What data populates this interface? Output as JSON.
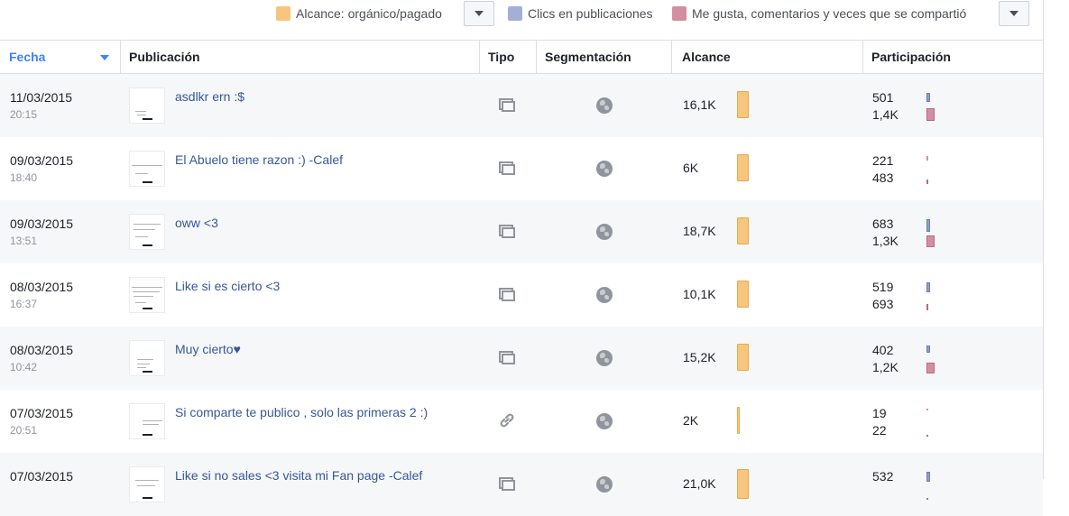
{
  "legend": {
    "items": [
      {
        "label": "Alcance: orgánico/pagado",
        "color": "#f7c67e"
      },
      {
        "label": "Clics en publicaciones",
        "color": "#a3afd4"
      },
      {
        "label": "Me gusta, comentarios y veces que se compartió",
        "color": "#d48ea1"
      }
    ]
  },
  "table": {
    "headers": {
      "fecha": "Fecha",
      "publicacion": "Publicación",
      "tipo": "Tipo",
      "segmentacion": "Segmentación",
      "alcance": "Alcance",
      "participacion": "Participación"
    },
    "rows": [
      {
        "date": "11/03/2015",
        "time": "20:15",
        "title": "asdlkr ern :$",
        "type_icon": "photo-icon",
        "targeting_icon": "globe-icon",
        "reach": "16,1K",
        "reach_value": 16100,
        "clicks": "501",
        "clicks_value": 501,
        "engagement": "1,4K",
        "engagement_value": 1400
      },
      {
        "date": "09/03/2015",
        "time": "18:40",
        "title": "El Abuelo tiene razon :) -Calef",
        "type_icon": "photo-icon",
        "targeting_icon": "globe-icon",
        "reach": "6K",
        "reach_value": 6000,
        "clicks": "221",
        "clicks_value": 221,
        "engagement": "483",
        "engagement_value": 483
      },
      {
        "date": "09/03/2015",
        "time": "13:51",
        "title": "oww <3",
        "type_icon": "photo-icon",
        "targeting_icon": "globe-icon",
        "reach": "18,7K",
        "reach_value": 18700,
        "clicks": "683",
        "clicks_value": 683,
        "engagement": "1,3K",
        "engagement_value": 1300
      },
      {
        "date": "08/03/2015",
        "time": "16:37",
        "title": "Like si es cierto <3",
        "type_icon": "photo-icon",
        "targeting_icon": "globe-icon",
        "reach": "10,1K",
        "reach_value": 10100,
        "clicks": "519",
        "clicks_value": 519,
        "engagement": "693",
        "engagement_value": 693
      },
      {
        "date": "08/03/2015",
        "time": "10:42",
        "title": "Muy cierto♥",
        "type_icon": "photo-icon",
        "targeting_icon": "globe-icon",
        "reach": "15,2K",
        "reach_value": 15200,
        "clicks": "402",
        "clicks_value": 402,
        "engagement": "1,2K",
        "engagement_value": 1200
      },
      {
        "date": "07/03/2015",
        "time": "20:51",
        "title": "Si comparte te publico , solo las primeras 2 :)",
        "type_icon": "link-icon",
        "targeting_icon": "globe-icon",
        "reach": "2K",
        "reach_value": 2000,
        "clicks": "19",
        "clicks_value": 19,
        "engagement": "22",
        "engagement_value": 22
      },
      {
        "date": "07/03/2015",
        "time": "",
        "title": "Like si no sales <3 visita mi Fan page -Calef",
        "type_icon": "photo-icon",
        "targeting_icon": "globe-icon",
        "reach": "21,0K",
        "reach_value": 21000,
        "clicks": "532",
        "clicks_value": 532,
        "engagement": "",
        "engagement_value": 0
      }
    ]
  }
}
